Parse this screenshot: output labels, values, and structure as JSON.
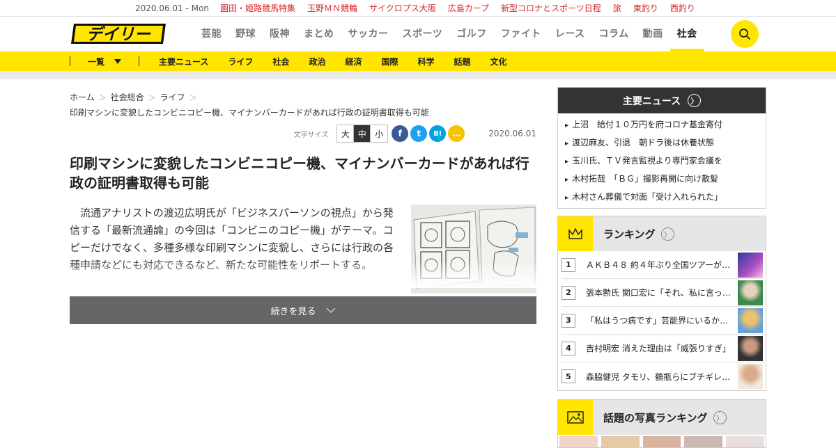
{
  "topbar": {
    "date": "2020.06.01 - Mon",
    "links": [
      "園田・姫路競馬特集",
      "玉野ＭＮ競輪",
      "サイクロプス大阪",
      "広島カープ",
      "新型コロナとスポーツ日程",
      "旅",
      "東釣り",
      "西釣り"
    ]
  },
  "header": {
    "logo_text": "デイリー",
    "nav": [
      "芸能",
      "野球",
      "阪神",
      "まとめ",
      "サッカー",
      "スポーツ",
      "ゴルフ",
      "ファイト",
      "レース",
      "コラム",
      "動画",
      "社会"
    ],
    "active_nav": "社会",
    "accent": "#ffe500"
  },
  "subnav": {
    "ichiran": "一覧",
    "cats": [
      "主要ニュース",
      "ライフ",
      "社会",
      "政治",
      "経済",
      "国際",
      "科学",
      "話題",
      "文化"
    ]
  },
  "article": {
    "breadcrumb": [
      "ホーム",
      "社会総合",
      "ライフ"
    ],
    "breadcrumb_title": "印刷マシンに変貌したコンビニコピー機、マイナンバーカードがあれば行政の証明書取得も可能",
    "font_size_label": "文字サイズ",
    "sizes": [
      "大",
      "中",
      "小"
    ],
    "share": [
      "f",
      "t",
      "B!",
      "…"
    ],
    "date": "2020.06.01",
    "title": "印刷マシンに変貌したコンビニコピー機、マイナンバーカードがあれば行政の証明書取得も可能",
    "lead": "流通アナリストの渡辺広明氏が「ビジネスパーソンの視点」から発信する「最新流通論」の今回は「コンビニのコピー機」がテーマ。コピーだけでなく、多種多様な印刷マシンに変貌し、さらには行政の各種申請などにも対応できるなど、新たな可能性をリポートする。",
    "more_label": "続きを見る"
  },
  "sidebar": {
    "main_news_title": "主要ニュース",
    "main_news": [
      "上沼　給付１０万円を府コロナ基金寄付",
      "渡辺麻友、引退　朝ドラ後は休養状態",
      "玉川氏、ＴＶ発言監視より専門家会議を",
      "木村拓哉　「ＢＧ」撮影再開に向け散髪",
      "木村さん葬儀で対面「受け入れられた」"
    ],
    "ranking_title": "ランキング",
    "ranking": [
      {
        "num": "1",
        "text": "ＡＫＢ４８ 約４年ぶり全国ツアーが…"
      },
      {
        "num": "2",
        "text": "張本勲氏 関口宏に「それ、私に言っ…"
      },
      {
        "num": "3",
        "text": "「私はうつ病です」芸能界にいるから…"
      },
      {
        "num": "4",
        "text": "吉村明宏 消えた理由は「威張りすぎ」"
      },
      {
        "num": "5",
        "text": "森脇健児 タモリ、鶴瓶らにブチギレ…"
      }
    ],
    "photo_ranking_title": "話題の写真ランキング"
  }
}
